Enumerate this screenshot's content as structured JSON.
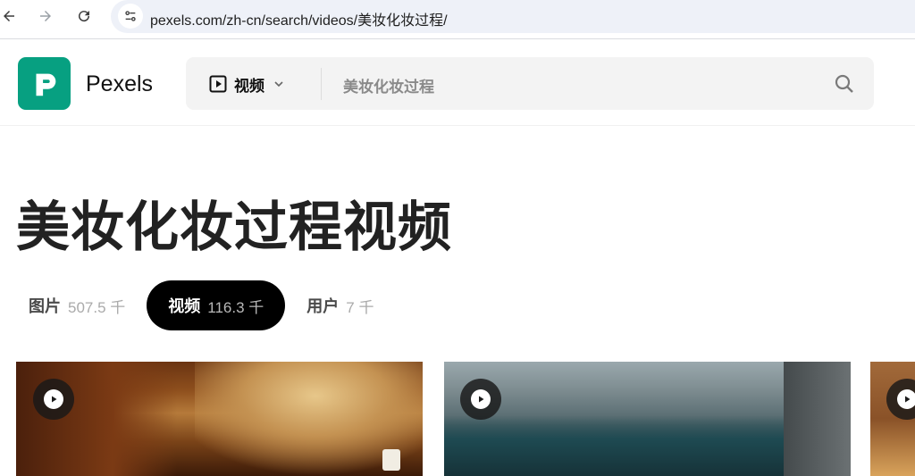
{
  "browser": {
    "url": "pexels.com/zh-cn/search/videos/美妆化妆过程/",
    "back_icon": "arrow-left-icon",
    "forward_icon": "arrow-right-icon",
    "reload_icon": "reload-icon",
    "site_settings_icon": "tune-icon"
  },
  "header": {
    "brand": "Pexels",
    "logo_icon": "pexels-logo-icon",
    "accent_color": "#07a081",
    "search": {
      "type_label": "视频",
      "type_icon": "video-icon",
      "query": "美妆化妆过程",
      "search_icon": "search-icon"
    }
  },
  "main": {
    "title": "美妆化妆过程视频",
    "tabs": [
      {
        "label": "图片",
        "count": "507.5 千",
        "active": false
      },
      {
        "label": "视频",
        "count": "116.3 千",
        "active": true
      },
      {
        "label": "用户",
        "count": "7 千",
        "active": false
      }
    ],
    "cards": [
      {
        "icon": "play-icon"
      },
      {
        "icon": "play-icon"
      },
      {
        "icon": "play-icon"
      }
    ]
  }
}
